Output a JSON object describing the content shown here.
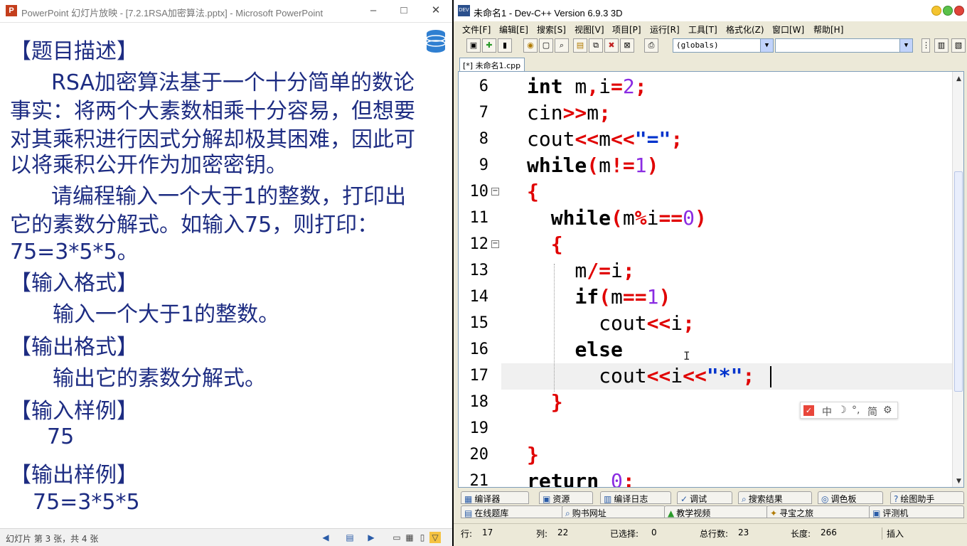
{
  "ppt": {
    "title": "PowerPoint 幻灯片放映 - [7.2.1RSA加密算法.pptx] - Microsoft PowerPoint",
    "app_icon": "P",
    "slide_lines": [
      "【题目描述】",
      "RSA加密算法基于一个十分简单的数论",
      "事实：将两个大素数相乘十分容易，但想要",
      "对其乘积进行因式分解却极其困难，因此可",
      "以将乘积公开作为加密密钥。",
      "请编程输入一个大于1的整数，打印出",
      "它的素数分解式。如输入75，则打印：",
      "75=3*5*5。",
      "【输入格式】",
      "输入一个大于1的整数。",
      "【输出格式】",
      "输出它的素数分解式。",
      "【输入样例】",
      "75",
      "【输出样例】",
      "75=3*5*5"
    ],
    "status": "幻灯片 第 3 张，共 4 张",
    "text_color": "#1d2c82"
  },
  "dev": {
    "title": "未命名1 - Dev-C++ Version 6.9.3  3D",
    "menu": [
      "文件[F]",
      "编辑[E]",
      "搜索[S]",
      "视图[V]",
      "项目[P]",
      "运行[R]",
      "工具[T]",
      "格式化(Z)",
      "窗口[W]",
      "帮助[H]"
    ],
    "globals_combo": "(globals)",
    "file_tab": "[*] 未命名1.cpp",
    "line_numbers": [
      "6",
      "7",
      "8",
      "9",
      "10",
      "11",
      "12",
      "13",
      "14",
      "15",
      "16",
      "17",
      "18",
      "19",
      "20",
      "21"
    ],
    "code": [
      [
        {
          "t": "int",
          "c": "k"
        },
        {
          "t": " m"
        },
        {
          "t": ",",
          "c": "p"
        },
        {
          "t": "i"
        },
        {
          "t": "=",
          "c": "p"
        },
        {
          "t": "2",
          "c": "n"
        },
        {
          "t": ";",
          "c": "p"
        }
      ],
      [
        {
          "t": "cin"
        },
        {
          "t": ">>",
          "c": "p"
        },
        {
          "t": "m"
        },
        {
          "t": ";",
          "c": "p"
        }
      ],
      [
        {
          "t": "cout"
        },
        {
          "t": "<<",
          "c": "p"
        },
        {
          "t": "m"
        },
        {
          "t": "<<",
          "c": "p"
        },
        {
          "t": "\"=\"",
          "c": "s"
        },
        {
          "t": ";",
          "c": "p"
        }
      ],
      [
        {
          "t": "while",
          "c": "k"
        },
        {
          "t": "(",
          "c": "p"
        },
        {
          "t": "m"
        },
        {
          "t": "!=",
          "c": "p"
        },
        {
          "t": "1",
          "c": "n"
        },
        {
          "t": ")",
          "c": "p"
        }
      ],
      [
        {
          "t": "{",
          "c": "p"
        }
      ],
      [
        {
          "t": "  "
        },
        {
          "t": "while",
          "c": "k"
        },
        {
          "t": "(",
          "c": "p"
        },
        {
          "t": "m"
        },
        {
          "t": "%",
          "c": "p"
        },
        {
          "t": "i"
        },
        {
          "t": "==",
          "c": "p"
        },
        {
          "t": "0",
          "c": "n"
        },
        {
          "t": ")",
          "c": "p"
        }
      ],
      [
        {
          "t": "  "
        },
        {
          "t": "{",
          "c": "p"
        }
      ],
      [
        {
          "t": "    m"
        },
        {
          "t": "/=",
          "c": "p"
        },
        {
          "t": "i"
        },
        {
          "t": ";",
          "c": "p"
        }
      ],
      [
        {
          "t": "    "
        },
        {
          "t": "if",
          "c": "k"
        },
        {
          "t": "(",
          "c": "p"
        },
        {
          "t": "m"
        },
        {
          "t": "==",
          "c": "p"
        },
        {
          "t": "1",
          "c": "n"
        },
        {
          "t": ")",
          "c": "p"
        }
      ],
      [
        {
          "t": "      cout"
        },
        {
          "t": "<<",
          "c": "p"
        },
        {
          "t": "i"
        },
        {
          "t": ";",
          "c": "p"
        }
      ],
      [
        {
          "t": "    "
        },
        {
          "t": "else",
          "c": "k"
        }
      ],
      [
        {
          "t": "      cout"
        },
        {
          "t": "<<",
          "c": "p"
        },
        {
          "t": "i"
        },
        {
          "t": "<<",
          "c": "p"
        },
        {
          "t": "\"*\"",
          "c": "s"
        },
        {
          "t": ";",
          "c": "p"
        }
      ],
      [
        {
          "t": "  "
        },
        {
          "t": "}",
          "c": "p"
        }
      ],
      [],
      [
        {
          "t": "}",
          "c": "p"
        }
      ],
      [
        {
          "t": "return",
          "c": "k"
        },
        {
          "t": " "
        },
        {
          "t": "0",
          "c": "n"
        },
        {
          "t": ";",
          "c": "p"
        }
      ]
    ],
    "ime_toolbar": [
      "中",
      "☽",
      "°,",
      "简",
      "⚙"
    ],
    "panel_tabs_row1": [
      "编译器",
      "资源",
      "编译日志",
      "调试",
      "搜索结果",
      "调色板",
      "绘图助手"
    ],
    "panel_tabs_row2": [
      "在线题库",
      "购书网址",
      "教学视频",
      "寻宝之旅",
      "评测机"
    ],
    "status": {
      "row_label": "行:",
      "row": "17",
      "col_label": "列:",
      "col": "22",
      "sel_label": "已选择:",
      "sel": "0",
      "total_label": "总行数:",
      "total": "23",
      "len_label": "长度:",
      "len": "266",
      "mode": "插入"
    },
    "colors": {
      "keyword": "#000000",
      "punct": "#e00000",
      "number": "#8a2be2",
      "string": "#0033cc"
    }
  }
}
